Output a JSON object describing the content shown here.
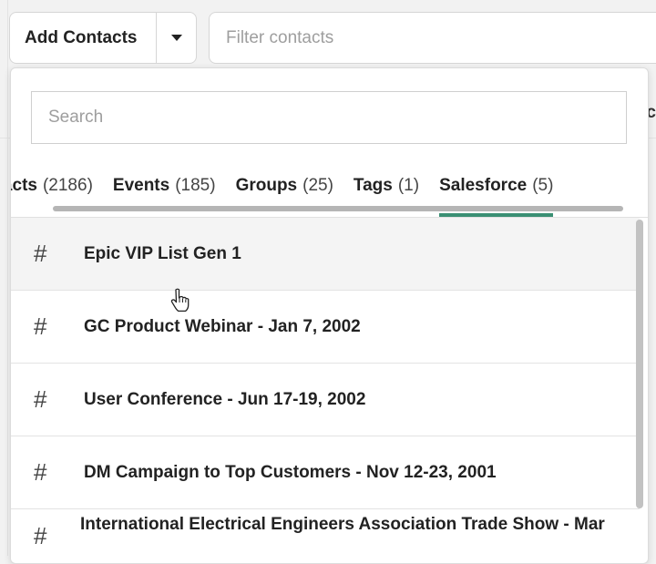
{
  "toolbar": {
    "add_contacts_label": "Add Contacts",
    "filter_placeholder": "Filter contacts"
  },
  "dropdown": {
    "search_placeholder": "Search",
    "tabs": [
      {
        "name": "Contacts",
        "count": "(2186)",
        "display": "ntacts"
      },
      {
        "name": "Events",
        "count": "(185)"
      },
      {
        "name": "Groups",
        "count": "(25)"
      },
      {
        "name": "Tags",
        "count": "(1)"
      },
      {
        "name": "Salesforce",
        "count": "(5)",
        "active": true
      }
    ],
    "items": [
      {
        "icon": "#",
        "title": "Epic VIP List Gen 1"
      },
      {
        "icon": "#",
        "title": "GC Product Webinar - Jan 7, 2002"
      },
      {
        "icon": "#",
        "title": "User Conference - Jun 17-19, 2002"
      },
      {
        "icon": "#",
        "title": "DM Campaign to Top Customers - Nov 12-23, 2001"
      },
      {
        "icon": "#",
        "title": "International Electrical Engineers Association Trade Show - Mar"
      }
    ]
  },
  "background": {
    "partial_letter": "c"
  },
  "colors": {
    "active_tab_underline": "#3a8f73"
  }
}
